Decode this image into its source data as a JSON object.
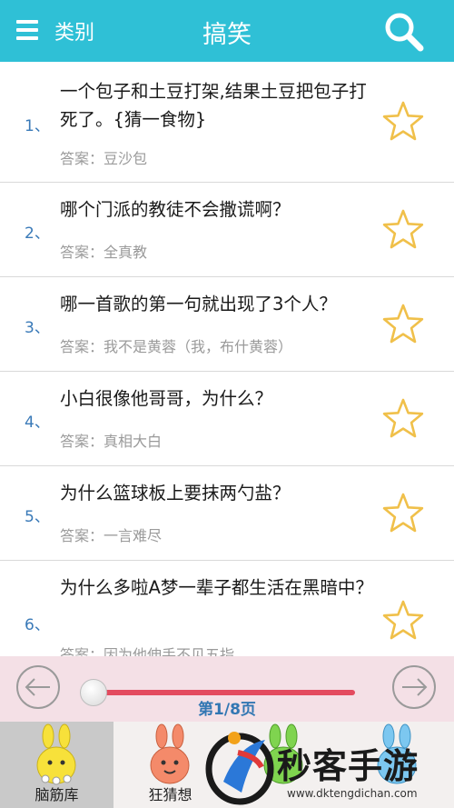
{
  "header": {
    "category_label": "类别",
    "title": "搞笑"
  },
  "riddles": [
    {
      "num": "1、",
      "question": "一个包子和土豆打架,结果土豆把包子打死了。{猜一食物}",
      "answer": "答案：豆沙包"
    },
    {
      "num": "2、",
      "question": "哪个门派的教徒不会撒谎啊？",
      "answer": "答案：全真教"
    },
    {
      "num": "3、",
      "question": "哪一首歌的第一句就出现了3个人？",
      "answer": "答案：我不是黄蓉（我，布什黄蓉）"
    },
    {
      "num": "4、",
      "question": "小白很像他哥哥，为什么？",
      "answer": "答案：真相大白"
    },
    {
      "num": "5、",
      "question": "为什么篮球板上要抹两勺盐？",
      "answer": "答案：一言难尽"
    },
    {
      "num": "6、",
      "question": "为什么多啦A梦一辈子都生活在黑暗中？",
      "answer": "答案：因为他伸手不见五指"
    }
  ],
  "pager": {
    "page_label": "第1/8页",
    "progress": 0.0
  },
  "tabs": [
    {
      "label": "脑筋库",
      "active": true
    },
    {
      "label": "狂猜想",
      "active": false
    },
    {
      "label": "",
      "active": false
    },
    {
      "label": "",
      "active": false
    }
  ],
  "watermark": {
    "text": "秒客手游",
    "url": "www.dktengdichan.com"
  },
  "colors": {
    "header": "#2fc0d6",
    "star": "#f0c04a",
    "answer_text": "#9a9a9a",
    "pager_bg": "#f4e0e6",
    "slider": "#e34b5f",
    "page_label": "#3277b3"
  }
}
